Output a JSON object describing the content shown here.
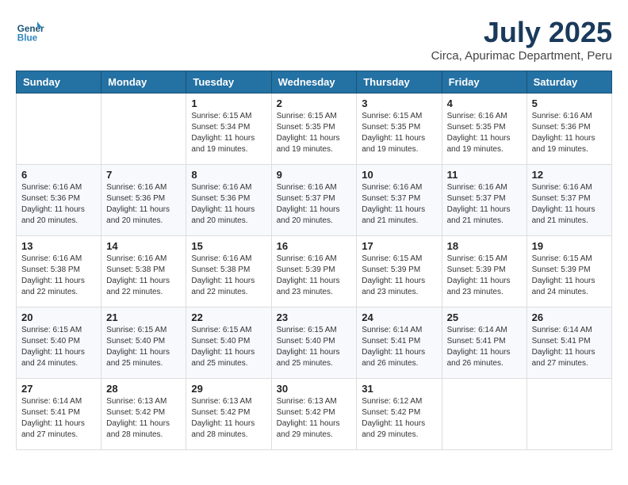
{
  "header": {
    "logo_general": "General",
    "logo_blue": "Blue",
    "month_title": "July 2025",
    "subtitle": "Circa, Apurimac Department, Peru"
  },
  "calendar": {
    "days_of_week": [
      "Sunday",
      "Monday",
      "Tuesday",
      "Wednesday",
      "Thursday",
      "Friday",
      "Saturday"
    ],
    "weeks": [
      [
        {
          "day": "",
          "info": ""
        },
        {
          "day": "",
          "info": ""
        },
        {
          "day": "1",
          "info": "Sunrise: 6:15 AM\nSunset: 5:34 PM\nDaylight: 11 hours and 19 minutes."
        },
        {
          "day": "2",
          "info": "Sunrise: 6:15 AM\nSunset: 5:35 PM\nDaylight: 11 hours and 19 minutes."
        },
        {
          "day": "3",
          "info": "Sunrise: 6:15 AM\nSunset: 5:35 PM\nDaylight: 11 hours and 19 minutes."
        },
        {
          "day": "4",
          "info": "Sunrise: 6:16 AM\nSunset: 5:35 PM\nDaylight: 11 hours and 19 minutes."
        },
        {
          "day": "5",
          "info": "Sunrise: 6:16 AM\nSunset: 5:36 PM\nDaylight: 11 hours and 19 minutes."
        }
      ],
      [
        {
          "day": "6",
          "info": "Sunrise: 6:16 AM\nSunset: 5:36 PM\nDaylight: 11 hours and 20 minutes."
        },
        {
          "day": "7",
          "info": "Sunrise: 6:16 AM\nSunset: 5:36 PM\nDaylight: 11 hours and 20 minutes."
        },
        {
          "day": "8",
          "info": "Sunrise: 6:16 AM\nSunset: 5:36 PM\nDaylight: 11 hours and 20 minutes."
        },
        {
          "day": "9",
          "info": "Sunrise: 6:16 AM\nSunset: 5:37 PM\nDaylight: 11 hours and 20 minutes."
        },
        {
          "day": "10",
          "info": "Sunrise: 6:16 AM\nSunset: 5:37 PM\nDaylight: 11 hours and 21 minutes."
        },
        {
          "day": "11",
          "info": "Sunrise: 6:16 AM\nSunset: 5:37 PM\nDaylight: 11 hours and 21 minutes."
        },
        {
          "day": "12",
          "info": "Sunrise: 6:16 AM\nSunset: 5:37 PM\nDaylight: 11 hours and 21 minutes."
        }
      ],
      [
        {
          "day": "13",
          "info": "Sunrise: 6:16 AM\nSunset: 5:38 PM\nDaylight: 11 hours and 22 minutes."
        },
        {
          "day": "14",
          "info": "Sunrise: 6:16 AM\nSunset: 5:38 PM\nDaylight: 11 hours and 22 minutes."
        },
        {
          "day": "15",
          "info": "Sunrise: 6:16 AM\nSunset: 5:38 PM\nDaylight: 11 hours and 22 minutes."
        },
        {
          "day": "16",
          "info": "Sunrise: 6:16 AM\nSunset: 5:39 PM\nDaylight: 11 hours and 23 minutes."
        },
        {
          "day": "17",
          "info": "Sunrise: 6:15 AM\nSunset: 5:39 PM\nDaylight: 11 hours and 23 minutes."
        },
        {
          "day": "18",
          "info": "Sunrise: 6:15 AM\nSunset: 5:39 PM\nDaylight: 11 hours and 23 minutes."
        },
        {
          "day": "19",
          "info": "Sunrise: 6:15 AM\nSunset: 5:39 PM\nDaylight: 11 hours and 24 minutes."
        }
      ],
      [
        {
          "day": "20",
          "info": "Sunrise: 6:15 AM\nSunset: 5:40 PM\nDaylight: 11 hours and 24 minutes."
        },
        {
          "day": "21",
          "info": "Sunrise: 6:15 AM\nSunset: 5:40 PM\nDaylight: 11 hours and 25 minutes."
        },
        {
          "day": "22",
          "info": "Sunrise: 6:15 AM\nSunset: 5:40 PM\nDaylight: 11 hours and 25 minutes."
        },
        {
          "day": "23",
          "info": "Sunrise: 6:15 AM\nSunset: 5:40 PM\nDaylight: 11 hours and 25 minutes."
        },
        {
          "day": "24",
          "info": "Sunrise: 6:14 AM\nSunset: 5:41 PM\nDaylight: 11 hours and 26 minutes."
        },
        {
          "day": "25",
          "info": "Sunrise: 6:14 AM\nSunset: 5:41 PM\nDaylight: 11 hours and 26 minutes."
        },
        {
          "day": "26",
          "info": "Sunrise: 6:14 AM\nSunset: 5:41 PM\nDaylight: 11 hours and 27 minutes."
        }
      ],
      [
        {
          "day": "27",
          "info": "Sunrise: 6:14 AM\nSunset: 5:41 PM\nDaylight: 11 hours and 27 minutes."
        },
        {
          "day": "28",
          "info": "Sunrise: 6:13 AM\nSunset: 5:42 PM\nDaylight: 11 hours and 28 minutes."
        },
        {
          "day": "29",
          "info": "Sunrise: 6:13 AM\nSunset: 5:42 PM\nDaylight: 11 hours and 28 minutes."
        },
        {
          "day": "30",
          "info": "Sunrise: 6:13 AM\nSunset: 5:42 PM\nDaylight: 11 hours and 29 minutes."
        },
        {
          "day": "31",
          "info": "Sunrise: 6:12 AM\nSunset: 5:42 PM\nDaylight: 11 hours and 29 minutes."
        },
        {
          "day": "",
          "info": ""
        },
        {
          "day": "",
          "info": ""
        }
      ]
    ]
  }
}
